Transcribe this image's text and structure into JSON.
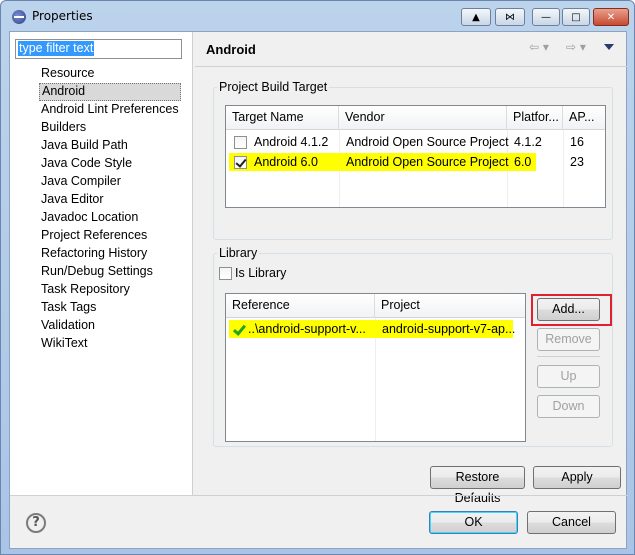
{
  "window": {
    "title": "Properties"
  },
  "sidebar": {
    "filter_text": "type filter text",
    "items": [
      "Resource",
      "Android",
      "Android Lint Preferences",
      "Builders",
      "Java Build Path",
      "Java Code Style",
      "Java Compiler",
      "Java Editor",
      "Javadoc Location",
      "Project References",
      "Refactoring History",
      "Run/Debug Settings",
      "Task Repository",
      "Task Tags",
      "Validation",
      "WikiText"
    ],
    "selected": "Android"
  },
  "page": {
    "title": "Android",
    "nav_icons": [
      "back-arrow-icon",
      "forward-arrow-icon",
      "dropdown-menu-icon"
    ]
  },
  "build_target": {
    "group_label": "Project Build Target",
    "columns": [
      "Target Name",
      "Vendor",
      "Platfor...",
      "AP..."
    ],
    "rows": [
      {
        "checked": false,
        "name": "Android 4.1.2",
        "vendor": "Android Open Source Project",
        "platform": "4.1.2",
        "api": "16",
        "highlight": false
      },
      {
        "checked": true,
        "name": "Android 6.0",
        "vendor": "Android Open Source Project",
        "platform": "6.0",
        "api": "23",
        "highlight": true
      }
    ]
  },
  "library": {
    "group_label": "Library",
    "is_library_label": "Is Library",
    "is_library_checked": false,
    "columns": [
      "Reference",
      "Project"
    ],
    "rows": [
      {
        "reference": "..\\android-support-v...",
        "project": "android-support-v7-ap...",
        "highlight": true,
        "status_icon": "green-check-icon"
      }
    ],
    "buttons": {
      "add": "Add...",
      "remove": "Remove",
      "up": "Up",
      "down": "Down"
    }
  },
  "footer": {
    "restore_defaults": "Restore Defaults",
    "apply": "Apply",
    "ok": "OK",
    "cancel": "Cancel"
  },
  "colors": {
    "highlight": "#ffff00",
    "annotation_box": "#e0202f",
    "selection": "#3399ff"
  }
}
